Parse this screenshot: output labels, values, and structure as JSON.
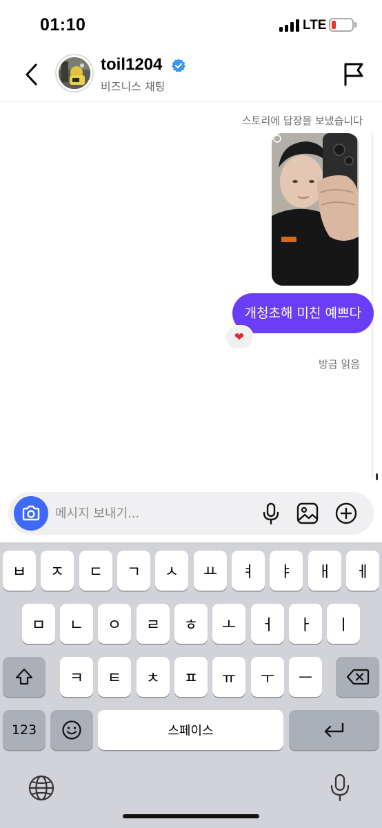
{
  "status_bar": {
    "time": "01:10",
    "network": "LTE"
  },
  "header": {
    "username": "toil1204",
    "subtitle": "비즈니스 채팅",
    "icons": {
      "back": "chevron-left-icon",
      "verified": "verified-badge-icon",
      "report": "flag-icon"
    }
  },
  "chat": {
    "story_reply_note": "스토리에 답장을 보냈습니다",
    "message": "개청초해 미친 예쁘다",
    "reaction": "❤",
    "read_receipt": "방금 읽음"
  },
  "composer": {
    "placeholder": "메시지 보내기...",
    "icons": {
      "camera": "camera-icon",
      "mic": "microphone-icon",
      "gallery": "image-icon",
      "add": "plus-circle-icon"
    }
  },
  "keyboard": {
    "row1": [
      "ㅂ",
      "ㅈ",
      "ㄷ",
      "ㄱ",
      "ㅅ",
      "ㅛ",
      "ㅕ",
      "ㅑ",
      "ㅐ",
      "ㅔ"
    ],
    "row2": [
      "ㅁ",
      "ㄴ",
      "ㅇ",
      "ㄹ",
      "ㅎ",
      "ㅗ",
      "ㅓ",
      "ㅏ",
      "ㅣ"
    ],
    "row3": [
      "ㅋ",
      "ㅌ",
      "ㅊ",
      "ㅍ",
      "ㅠ",
      "ㅜ",
      "ㅡ"
    ],
    "numbers_label": "123",
    "space_label": "스페이스"
  },
  "colors": {
    "accent": "#6a3df7",
    "camera": "#3f6af6",
    "verified": "#3897f0",
    "battery": "#e8372c"
  }
}
